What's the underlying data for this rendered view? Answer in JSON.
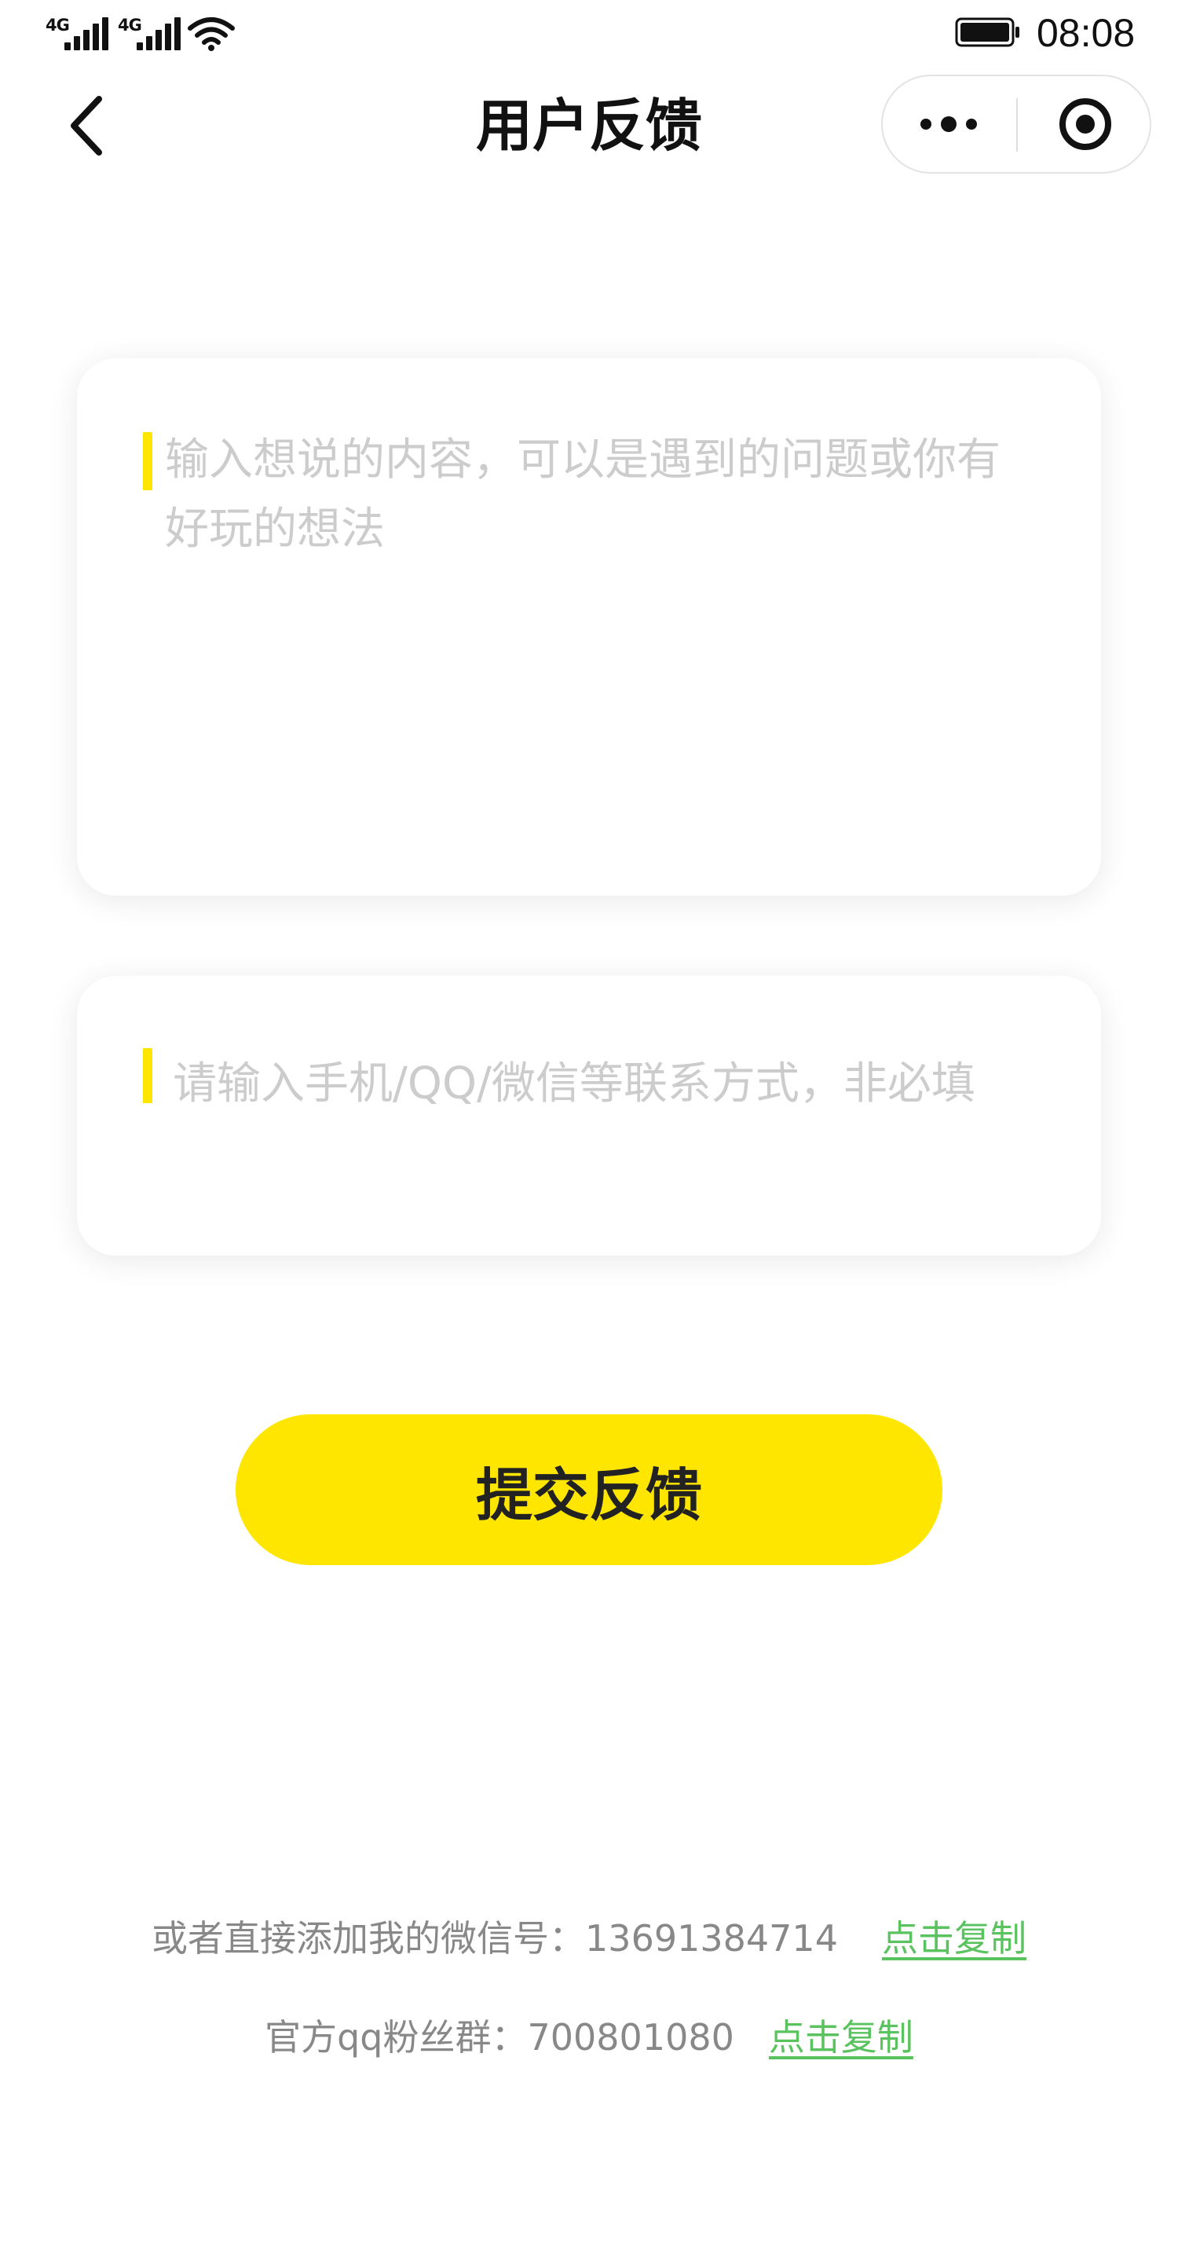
{
  "status_bar": {
    "signal_1_label": "4G",
    "signal_2_label": "4G",
    "time": "08:08",
    "icons": [
      "signal-icon",
      "signal-icon",
      "wifi-icon",
      "battery-icon"
    ]
  },
  "nav": {
    "title": "用户反馈",
    "back_icon": "chevron-left-icon",
    "more_icon": "more-dots-icon",
    "close_icon": "target-circle-icon"
  },
  "form": {
    "content_placeholder": "输入想说的内容，可以是遇到的问题或你有好玩的想法",
    "contact_placeholder": "请输入手机/QQ/微信等联系方式，非必填",
    "submit_label": "提交反馈"
  },
  "footer": {
    "wechat_text": "或者直接添加我的微信号：13691384714",
    "wechat_copy_label": "点击复制",
    "qq_text": "官方qq粉丝群：700801080",
    "qq_copy_label": "点击复制"
  },
  "colors": {
    "accent": "#ffe600",
    "link": "#5ac35f",
    "placeholder": "#cccccc",
    "footer_text": "#888888"
  }
}
